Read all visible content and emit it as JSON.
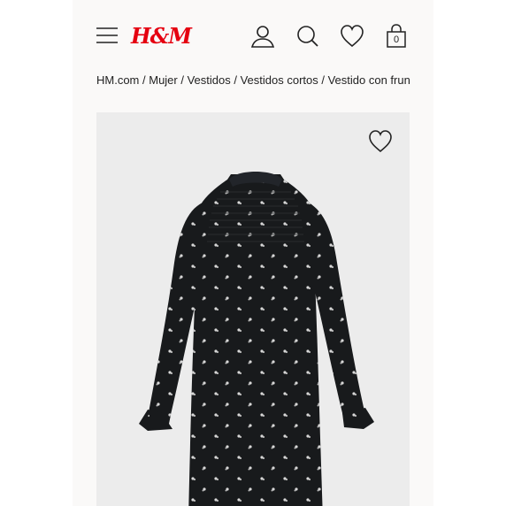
{
  "header": {
    "logo_text": "H&M",
    "brand_color": "#e50010",
    "icons": [
      "menu-icon",
      "account-icon",
      "search-icon",
      "favorites-icon",
      "cart-icon"
    ],
    "cart_count": "0"
  },
  "breadcrumb": [
    "HM.com",
    "Mujer",
    "Vestidos",
    "Vestidos cortos",
    "Vestido con frun"
  ],
  "product": {
    "image": "black-floral-print-dress",
    "favorite_icon": "heart-outline-icon"
  }
}
